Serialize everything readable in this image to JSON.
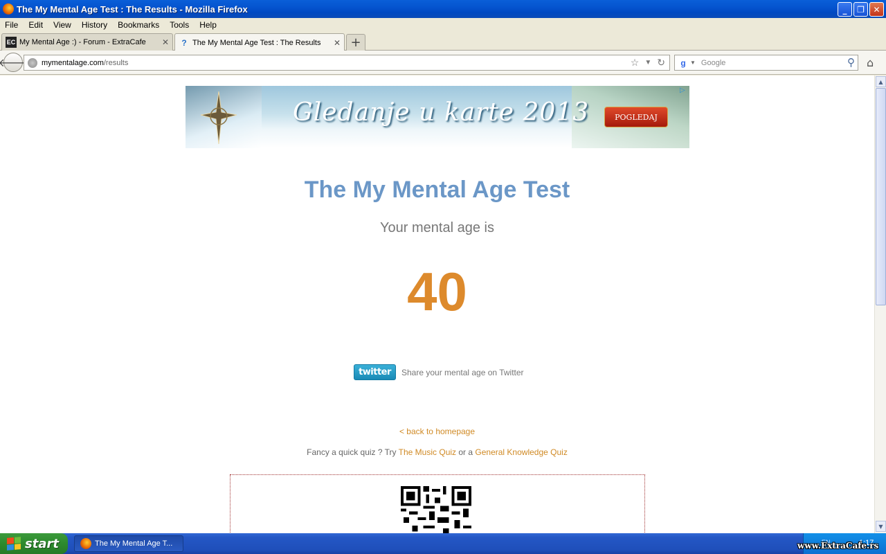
{
  "window": {
    "title": "The My Mental Age Test : The Results - Mozilla Firefox",
    "minimize": "_",
    "restore": "❐",
    "close": "✕"
  },
  "menu": [
    "File",
    "Edit",
    "View",
    "History",
    "Bookmarks",
    "Tools",
    "Help"
  ],
  "tabs": [
    {
      "label": "My Mental Age :) - Forum - ExtraCafe",
      "favicon": "EC",
      "active": false
    },
    {
      "label": "The My Mental Age Test : The Results",
      "favicon": "?",
      "active": true
    }
  ],
  "navbar": {
    "url_domain": "mymentalage.com",
    "url_path": "/results",
    "search_placeholder": "Google"
  },
  "banner": {
    "text": "Gledanje u karte 2013",
    "button": "POGLEDAJ"
  },
  "page": {
    "title": "The My Mental Age Test",
    "subtitle": "Your mental age is",
    "age": "40",
    "twitter_button": "twitter",
    "share_text": "Share your mental age on Twitter",
    "back_link": "< back to homepage",
    "quiz_prefix": "Fancy a quick quiz ? Try",
    "quiz_music": "The Music Quiz",
    "quiz_or": "or a",
    "quiz_general": "General Knowledge Quiz"
  },
  "taskbar": {
    "start": "start",
    "item": "The My Mental Age T...",
    "lang": "EN",
    "clock": "1:17"
  },
  "watermark": "www.ExtraCafe.rs",
  "colors": {
    "title_blue": "#6b97c7",
    "age_orange": "#dd8a2c",
    "link_orange": "#d08a25"
  }
}
